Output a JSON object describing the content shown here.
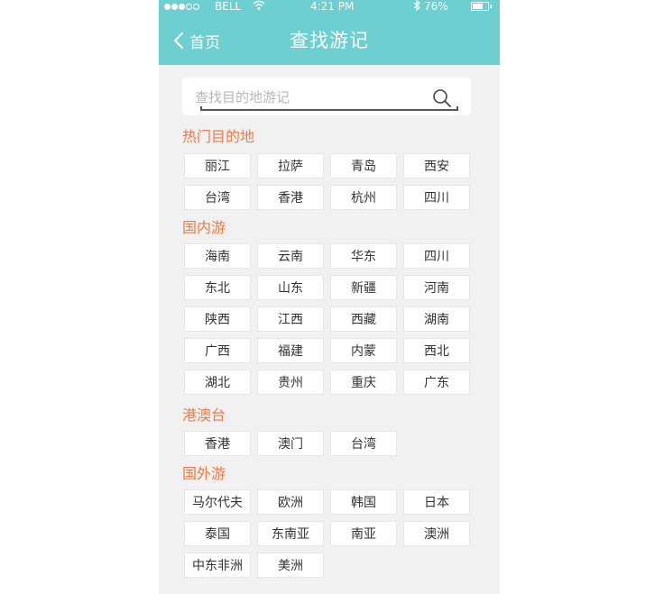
{
  "status_bar": {
    "carrier": "BELL",
    "time": "4:21 PM",
    "battery": "76%",
    "battery_level": 0.76
  },
  "nav": {
    "back_label": "首页",
    "title": "查找游记"
  },
  "search": {
    "placeholder": "查找目的地游记"
  },
  "sections": [
    {
      "title": "热门目的地",
      "items": [
        "丽江",
        "拉萨",
        "青岛",
        "西安",
        "台湾",
        "香港",
        "杭州",
        "四川"
      ]
    },
    {
      "title": "国内游",
      "items": [
        "海南",
        "云南",
        "华东",
        "四川",
        "东北",
        "山东",
        "新疆",
        "河南",
        "陕西",
        "江西",
        "西藏",
        "湖南",
        "广西",
        "福建",
        "内蒙",
        "西北",
        "湖北",
        "贵州",
        "重庆",
        "广东"
      ]
    },
    {
      "title": "港澳台",
      "items": [
        "香港",
        "澳门",
        "台湾"
      ]
    },
    {
      "title": "国外游",
      "items": [
        "马尔代夫",
        "欧洲",
        "韩国",
        "日本",
        "泰国",
        "东南亚",
        "南亚",
        "澳洲",
        "中东非洲",
        "美洲"
      ]
    }
  ],
  "colors": {
    "header": "#6dcfd0",
    "section_title": "#ec7b48",
    "background": "#f1f1f1"
  }
}
